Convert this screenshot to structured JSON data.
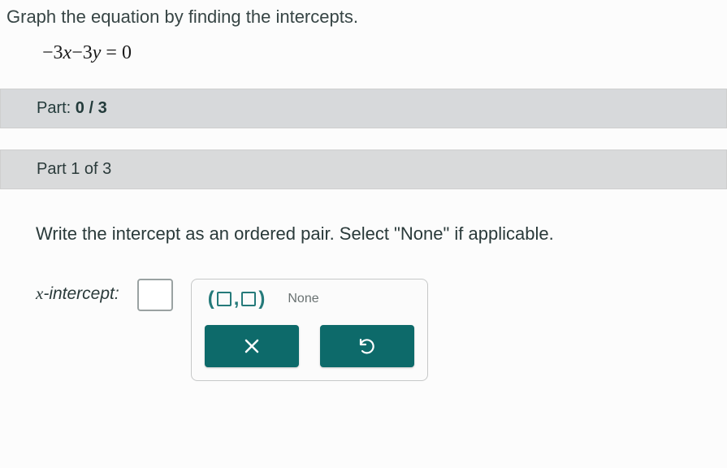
{
  "question": {
    "title": "Graph the equation by finding the intercepts.",
    "equation_display": "−3x−3y = 0"
  },
  "progress": {
    "label_prefix": "Part: ",
    "current": "0",
    "separator": " / ",
    "total": "3"
  },
  "part": {
    "header": "Part 1 of 3",
    "instruction": "Write the intercept as an ordered pair. Select \"None\" if applicable.",
    "intercept_label": "x-intercept:"
  },
  "tools": {
    "ordered_pair_template": "(▢,▢)",
    "none_label": "None"
  }
}
